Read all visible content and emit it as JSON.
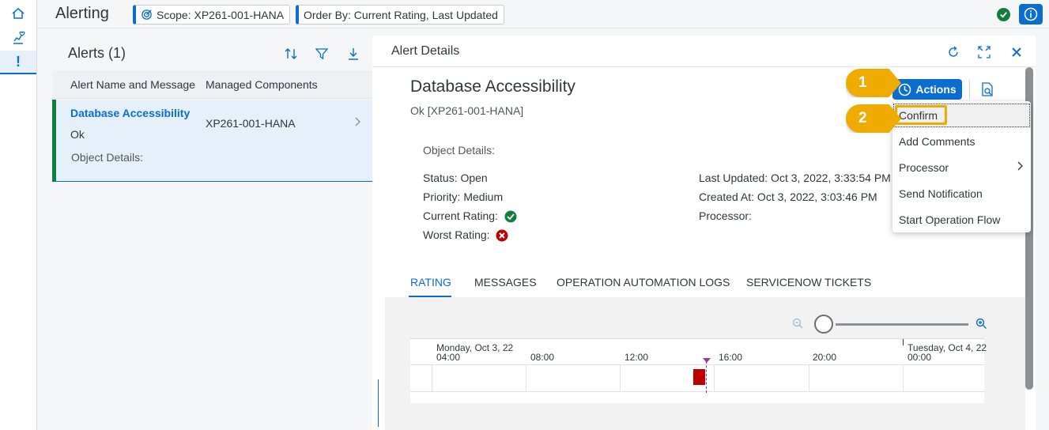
{
  "header": {
    "title": "Alerting",
    "scope_chip": "Scope: XP261-001-HANA",
    "order_chip": "Order By: Current Rating, Last Updated"
  },
  "rail": {
    "items": [
      "home-icon",
      "health-monitoring-icon",
      "alerts-icon"
    ],
    "active_label": "!"
  },
  "alerts_list": {
    "title": "Alerts (1)",
    "columns": [
      "Alert Name and Message",
      "Managed Components"
    ],
    "rows": [
      {
        "name": "Database Accessibility",
        "status": "Ok",
        "object_details": "Object Details:",
        "component": "XP261-001-HANA"
      }
    ]
  },
  "details": {
    "panel_title": "Alert Details",
    "title": "Database Accessibility",
    "subtitle": "Ok [XP261-001-HANA]",
    "object_details_label": "Object Details:",
    "status": "Status: Open",
    "priority": "Priority: Medium",
    "current_rating": "Current Rating:",
    "worst_rating": "Worst Rating:",
    "last_updated": "Last Updated: Oct 3, 2022, 3:33:54 PM",
    "created_at": "Created At: Oct 3, 2022, 3:03:46 PM",
    "processor": "Processor:",
    "tabs": [
      "RATING",
      "MESSAGES",
      "OPERATION AUTOMATION LOGS",
      "SERVICENOW TICKETS"
    ],
    "active_tab": "RATING"
  },
  "timeline": {
    "day1": "Monday, Oct 3, 22",
    "day2": "Tuesday, Oct 4, 22",
    "ticks": [
      "04:00",
      "08:00",
      "12:00",
      "16:00",
      "20:00",
      "00:00"
    ]
  },
  "actions": {
    "button_label": "Actions",
    "menu": [
      "Confirm",
      "Add Comments",
      "Processor",
      "Send Notification",
      "Start Operation Flow"
    ]
  },
  "callouts": [
    "1",
    "2"
  ],
  "colors": {
    "accent": "#0a6ed1",
    "positive": "#107e3e",
    "negative": "#bb0000",
    "callout": "#f0ab00"
  }
}
